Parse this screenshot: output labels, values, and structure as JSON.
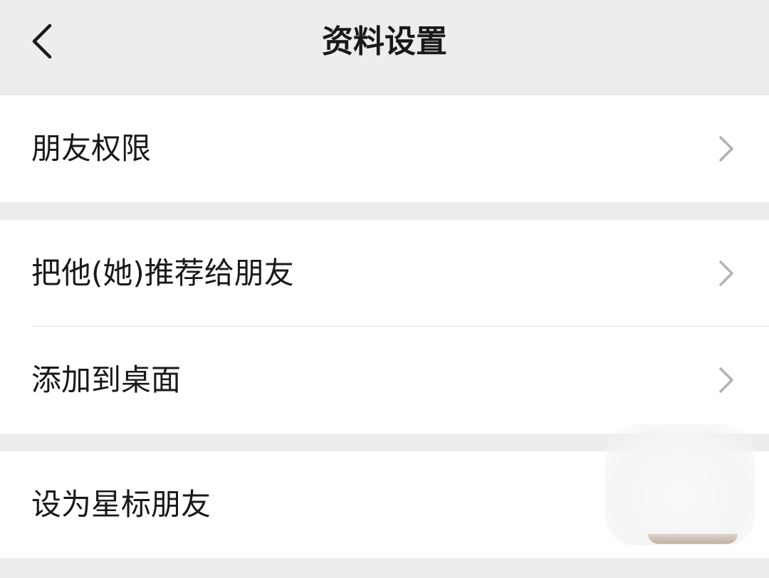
{
  "nav": {
    "title": "资料设置",
    "back_icon": "chevron-left-icon"
  },
  "groups": [
    {
      "items": [
        {
          "label": "朋友权限",
          "has_chevron": true
        }
      ]
    },
    {
      "items": [
        {
          "label": "把他(她)推荐给朋友",
          "has_chevron": true
        },
        {
          "label": "添加到桌面",
          "has_chevron": true
        }
      ]
    },
    {
      "items": [
        {
          "label": "设为星标朋友",
          "has_chevron": false
        }
      ]
    }
  ],
  "colors": {
    "background": "#ededed",
    "surface": "#ffffff",
    "text": "#191919",
    "chevron": "#b2b2b2",
    "divider": "#e3e3e3"
  }
}
